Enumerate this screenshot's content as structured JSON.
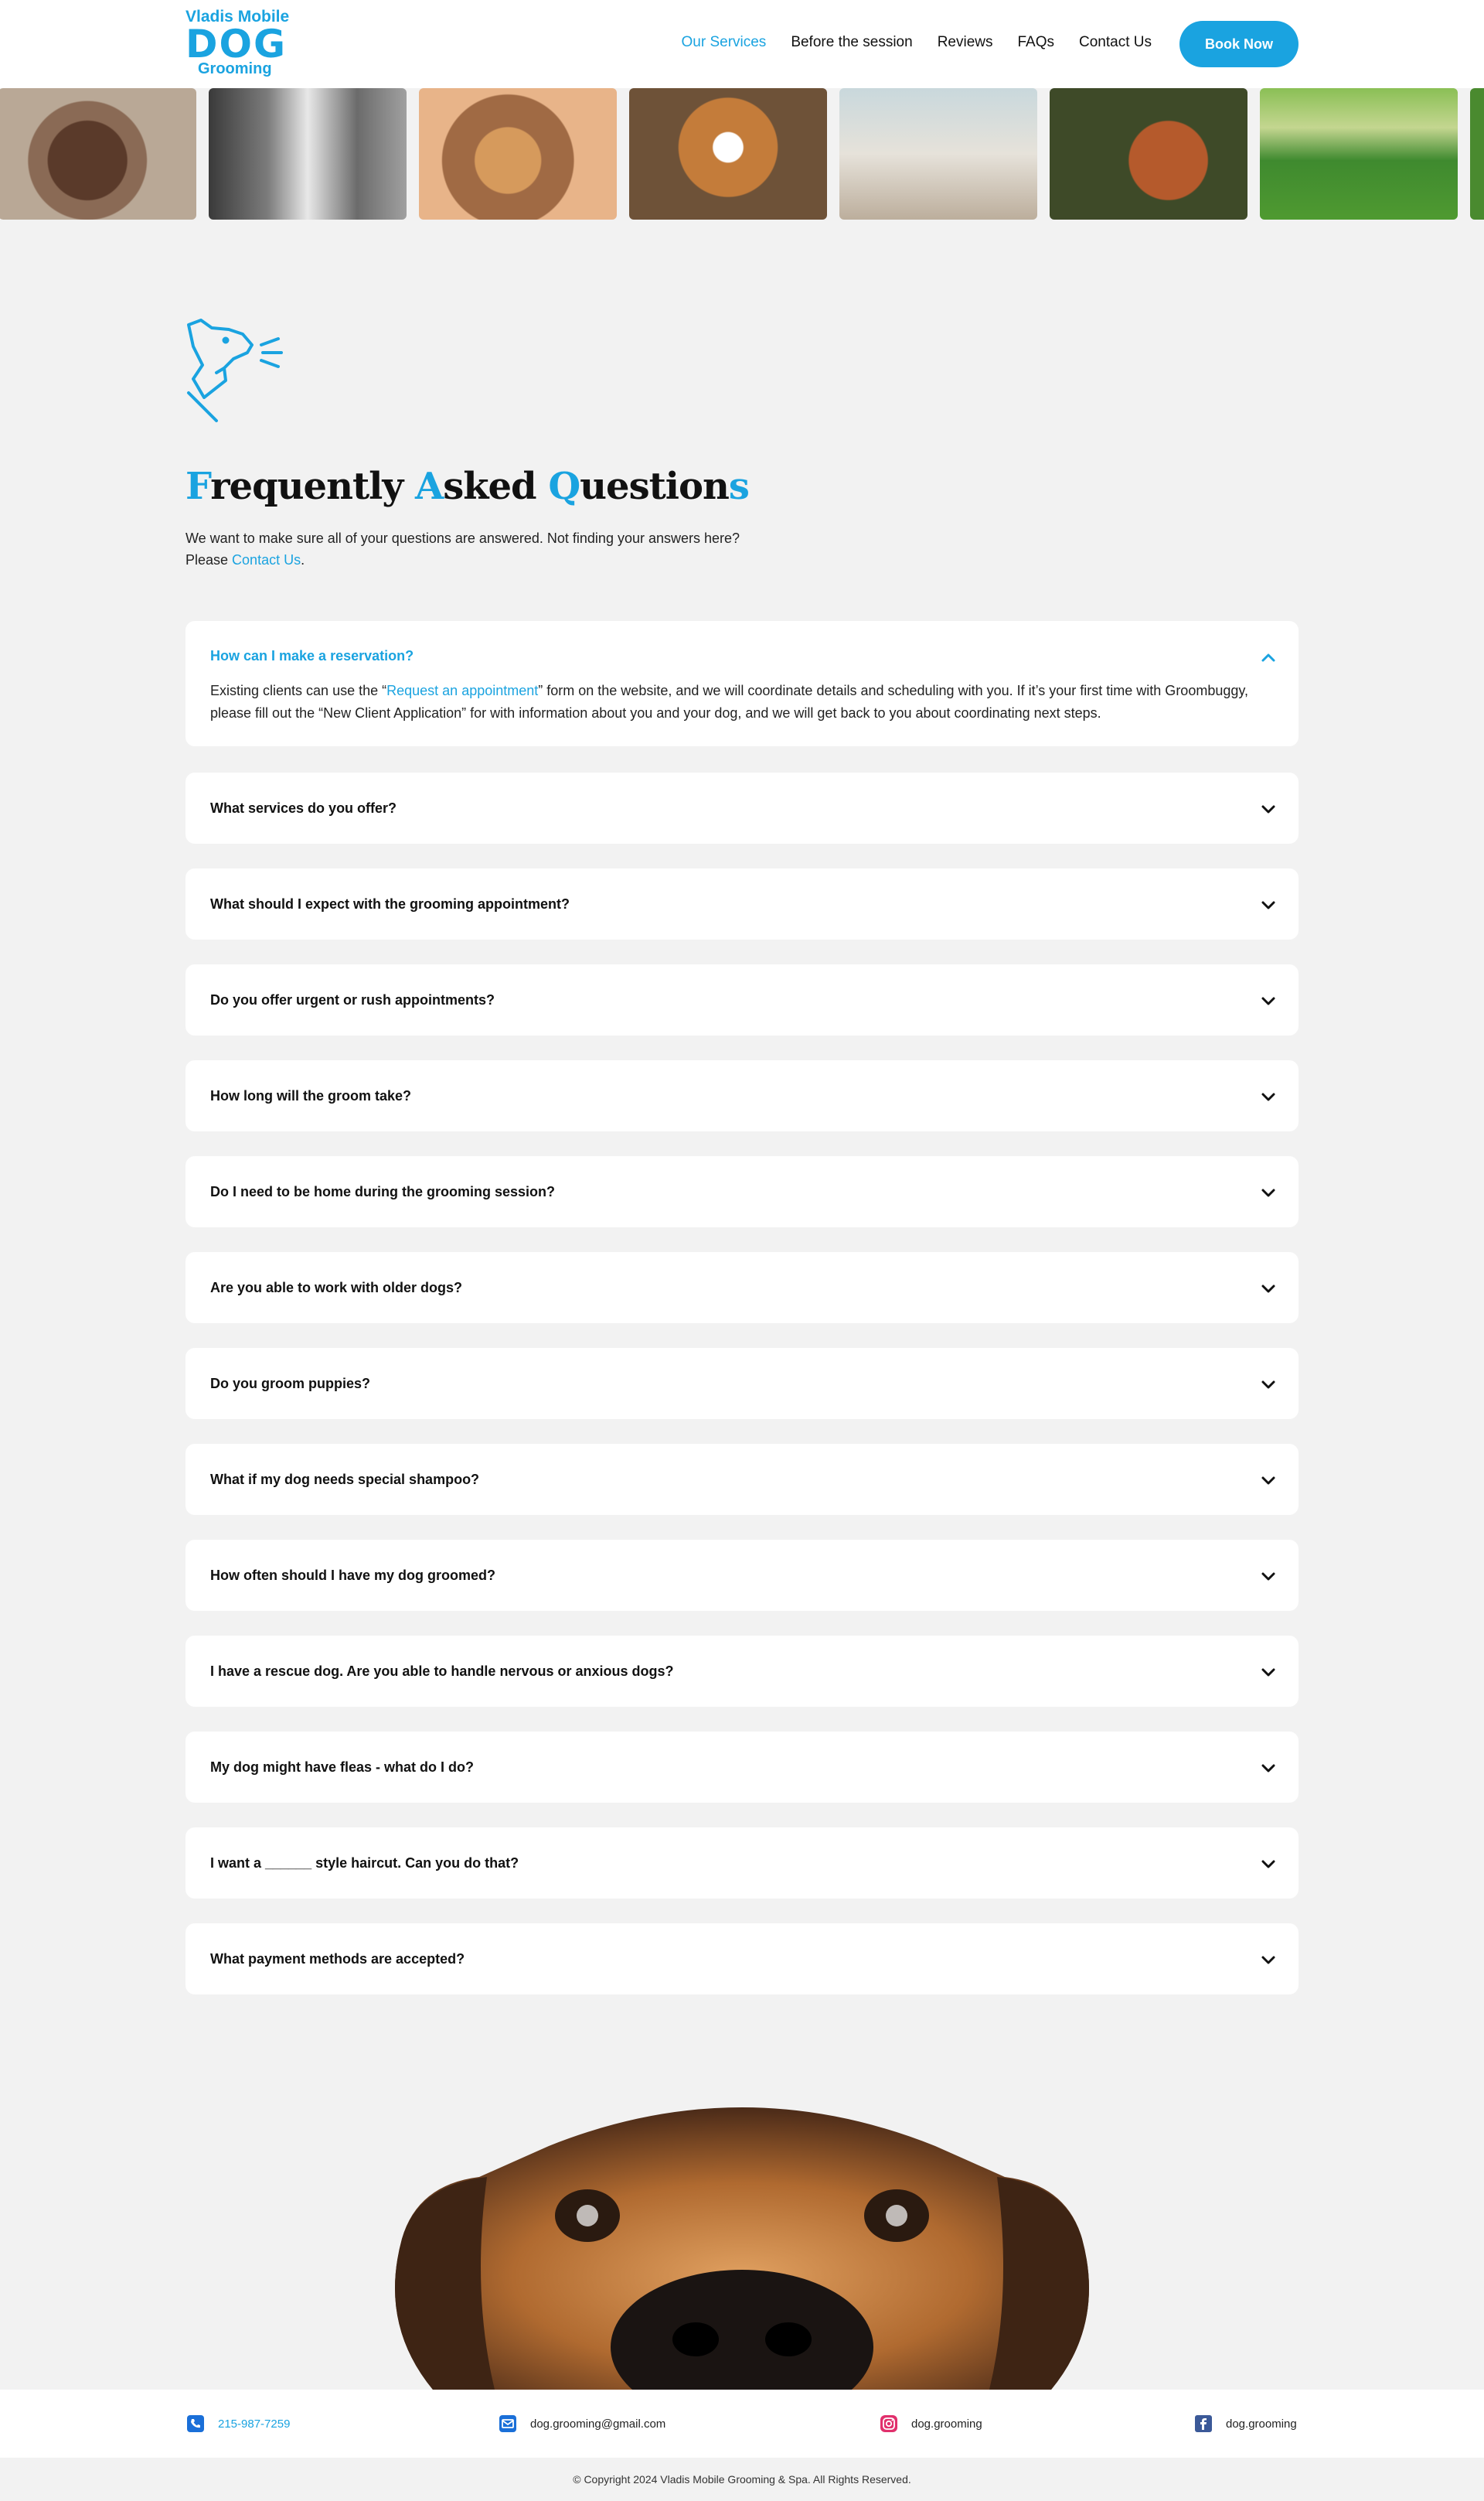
{
  "brand": {
    "line1": "Vladis Mobile",
    "line2": "DOG",
    "line3": "Grooming",
    "color": "#1aa3e0"
  },
  "nav": {
    "items": [
      {
        "label": "Our Services",
        "active": true
      },
      {
        "label": "Before the session"
      },
      {
        "label": "Reviews"
      },
      {
        "label": "FAQs"
      },
      {
        "label": "Contact Us"
      }
    ],
    "cta": "Book Now"
  },
  "gallery": [
    "dog-photo-1",
    "dog-photo-2",
    "dog-photo-3",
    "dog-photo-4",
    "dog-photo-5",
    "dog-photo-6",
    "dog-photo-7"
  ],
  "faq": {
    "title_parts": [
      {
        "t": "F",
        "h": true
      },
      {
        "t": "requently ",
        "h": false
      },
      {
        "t": "A",
        "h": true
      },
      {
        "t": "sked ",
        "h": false
      },
      {
        "t": "Q",
        "h": true
      },
      {
        "t": "uestion",
        "h": false
      },
      {
        "t": "s",
        "h": true
      }
    ],
    "intro_line1": "We want to make sure all of your questions are answered. Not finding your answers here?",
    "intro_line2_a": "Please ",
    "intro_link": "Contact Us",
    "intro_line2_b": ".",
    "items": [
      {
        "q": "How can I make a reservation?",
        "open": true,
        "a1": "Existing clients can use the “",
        "link": "Request an appointment",
        "a2": "” form on the website, and we will coordinate details and scheduling with you. If it’s your first time with Groombuggy, please fill out the “New Client Application” for with information about you and your dog, and we will get back to you about coordinating next steps."
      },
      {
        "q": "What services do you offer?"
      },
      {
        "q": "What should I expect with the grooming appointment?"
      },
      {
        "q": "Do you offer urgent or rush appointments?"
      },
      {
        "q": "How long will the groom take?"
      },
      {
        "q": "Do I need to be home during the grooming session?"
      },
      {
        "q": "Are you able to work with older dogs?"
      },
      {
        "q": "Do you groom puppies?"
      },
      {
        "q": "What if my dog needs special shampoo?"
      },
      {
        "q": "How often should I have my dog groomed?"
      },
      {
        "q": "I have a rescue dog. Are you able to handle nervous or anxious dogs?"
      },
      {
        "q": "My dog might have fleas - what do I do?"
      },
      {
        "q": "I want a ______ style haircut. Can you do that?"
      },
      {
        "q": "What payment methods are accepted?"
      }
    ]
  },
  "contact": {
    "phone": "215-987-7259",
    "email": "dog.grooming@gmail.com",
    "instagram": "dog.grooming",
    "facebook": "dog.grooming"
  },
  "copyright": "© Copyright 2024 Vladis Mobile Grooming & Spa. All Rights Reserved."
}
